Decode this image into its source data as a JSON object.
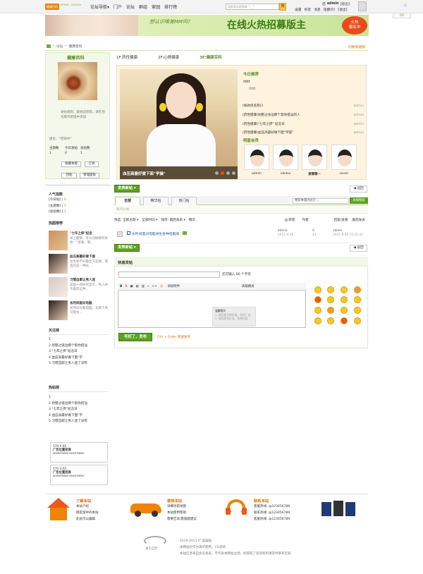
{
  "topbar": {
    "logo_badge": "健康百科",
    "logo_sub": "FRESH · HEALTH",
    "nav": [
      "论坛导航▾",
      "门户",
      "论坛",
      "群组",
      "家园",
      "排行榜"
    ],
    "search_placeholder": "搜索其实很简单 ^_^",
    "search_btn": "搜",
    "user_line": [
      "您",
      "admin",
      "[退出]"
    ],
    "user_nav": [
      "设置",
      "好友",
      "消息",
      "提醒(0)",
      "[退出]"
    ],
    "diy": "DIY",
    "close": "✕"
  },
  "banner": {
    "mid_text": "想认识唯美MM吗?",
    "big_text": "在线火热招募版主",
    "sign_text": [
      "火热",
      "报名中"
    ]
  },
  "breadcrumb": [
    "论坛",
    "健康百科"
  ],
  "switch_style": "切换到宽版",
  "left": {
    "title": "健康百科",
    "desc": "发帖规则、版规说明等，请在后台版块管理中添加",
    "master": "版主：*空缺中*",
    "stats_labels": [
      "主题数",
      "今日发帖",
      "总帖数"
    ],
    "stats_values": [
      "1",
      "0",
      "1"
    ],
    "buttons": [
      "收藏本版",
      "订阅",
      "回帖",
      "管理面板"
    ],
    "hot_index_title": "人气指数",
    "hot_index": [
      {
        "label": "[今日帖]",
        "value": "0"
      },
      {
        "label": "[主题数]",
        "value": "1"
      },
      {
        "label": "[总帖数]",
        "value": "1"
      }
    ],
    "hot_pics_title": "热图推荐",
    "hot_pics": [
      {
        "title": "\"七年之痒\"纪念",
        "desc": "早上醒来，老公问她情何依依：\"老婆，我…"
      },
      {
        "title": "血压高最好做下面",
        "desc": "往生保不好最佳方案做，而且也是一种长…"
      },
      {
        "title": "习惯自欺让男人迷",
        "desc": "美国一项研究显示，男人并不喜欢这种…"
      },
      {
        "title": "长时间面对电脑",
        "desc": "长时间对着电脑，长期下来可能会…"
      }
    ],
    "focus_title": "关注榜",
    "focus": [
      "1 .",
      "2 别墅过道边那个帮你搭讪",
      "3 \"七年之痒\"纪念日",
      "4 血压高最好做下面\"学",
      "5 习惯自欺让男人迷了没有"
    ],
    "hot_posts_title": "热帖榜",
    "hot_posts": [
      "1 .",
      "2 别墅过道边那个帮你搭讪",
      "3 \"七年之痒\"纪念日",
      "4 血压高最好做下面\"学",
      "5 习惯自欺让男人迷了没有"
    ],
    "ads": [
      {
        "size": "170 X 65",
        "title": "广告位置招商",
        "sub": "ADVERTISING INVESTMENT"
      },
      {
        "size": "170 X 65",
        "title": "广告位置招商",
        "sub": "ADVERTISING INVESTMENT"
      }
    ]
  },
  "main": {
    "floors": [
      "1F:药性健康",
      "2F:心情健康",
      "3F:健康百科"
    ],
    "slide_caption": "血压高最好做下面\"学操\"",
    "today_title": "今日推荐",
    "today_item": "ddd",
    "today_sub": "ddd",
    "news": [
      {
        "text": "(帐款块名称)1",
        "user": "admin"
      },
      {
        "text": "(药性健康)别墅过身边那个帮你搭讪的人",
        "user": "admin"
      },
      {
        "text": "(药性健康)\"七年之痒\" 纪念日",
        "user": "admin"
      },
      {
        "text": "(药性健康)血压高最好做下面\"学操\"",
        "user": "admin"
      }
    ],
    "stars_title": "明星会员",
    "stars": [
      "admin",
      "iokdso",
      "爱哪哪一",
      "ecom"
    ],
    "post_btn": "发表新帖 ▾",
    "back_btn": "◀ 返回",
    "tabs": [
      "全部",
      "精华帖",
      "热门帖"
    ],
    "search_in_placeholder": "搜索本版内帖子…",
    "search_in_btn": "本版搜索",
    "section_label": "板块分类",
    "filter": [
      "筛选: 全部主题 ▾",
      "全部时间 ▾",
      "排序: 最后发表 ▾",
      "精华"
    ],
    "filter_right": [
      "新窗",
      "作者",
      "回复/查看",
      "最后发表"
    ],
    "thread": {
      "title": "长时间面对电脑进生各种电脑病",
      "author": "admin",
      "author_date": "2011-9-26",
      "replies": "0",
      "views": "21",
      "last_user": "admin",
      "last_date": "2011-9-26 15:11:43"
    },
    "quick_title": "快速发帖",
    "title_hint": "还可输入 80 个字符",
    "editor_toolbar": [
      "B",
      "A",
      "▣",
      "▤",
      "▥",
      "«",
      "<>",
      "☺",
      "添加附件",
      "高级模式"
    ],
    "tip_title": "温馨提示",
    "tip_lines": [
      "1. 请注意文明用语，勿发广告",
      "2. 请勿发布反动、色情内容"
    ],
    "submit": "写好了，发布",
    "ctrl_enter": "Ctrl + Enter 快速发布"
  },
  "footer": {
    "cols": [
      {
        "title": "了解本站",
        "items": [
          "本站介绍",
          "网友留中的本站",
          "此处可以编辑"
        ]
      },
      {
        "title": "使用本站",
        "items": [
          "详细导航地图",
          "本站使用帮助",
          "需要告诉/客服题建议"
        ]
      },
      {
        "title": "联系本站",
        "items": [
          "客服热线: @123456789",
          "联系热线: @123456789",
          "客服热线: @123456789"
        ]
      }
    ],
    "logo_text": "源于自然",
    "info": [
      "2010-2011  IT 蓝猫猫",
      "本网站仅作为演示使用，CG测试",
      "本站信息来自会员发表，不代表本网站立场，如侵犯了您的权利请及时联系告知"
    ]
  }
}
